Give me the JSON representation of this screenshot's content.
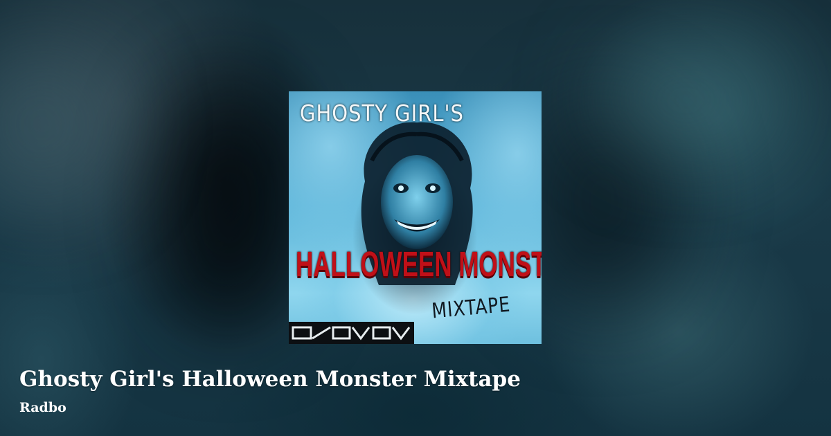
{
  "track": {
    "title": "Ghosty Girl's Halloween Monster Mixtape",
    "artist": "Radbo"
  },
  "cover_art": {
    "title_top": "GHOSTY GIRL'S",
    "title_main": "HALLOWEEN MONSTER",
    "title_sub": "MIXTAPE"
  },
  "colors": {
    "title_text": "#ffffff",
    "cover_accent_red": "#c01018",
    "cover_blue": "#59b3d8"
  }
}
